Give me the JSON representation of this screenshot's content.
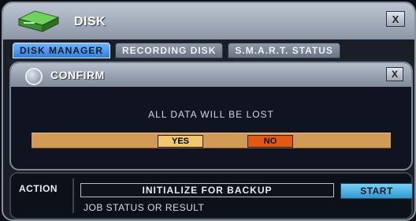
{
  "window": {
    "title": "DISK",
    "close_label": "X"
  },
  "tabs": [
    {
      "label": "DISK MANAGER",
      "active": true
    },
    {
      "label": "RECORDING DISK",
      "active": false
    },
    {
      "label": "S.M.A.R.T. STATUS",
      "active": false
    }
  ],
  "dialog": {
    "title": "CONFIRM",
    "close_label": "X",
    "message": "ALL DATA WILL BE LOST",
    "yes_label": "YES",
    "no_label": "NO"
  },
  "action": {
    "label": "ACTION",
    "value": "INITIALIZE FOR BACKUP",
    "start_label": "START",
    "status_text": "JOB STATUS OR RESULT"
  },
  "colors": {
    "accent_tab": "#2f7fdc",
    "button_bar": "#d29a57",
    "yes_button": "#f0c86b",
    "no_button": "#e25a12",
    "start_button": "#2f98d2"
  },
  "icons": {
    "window_icon": "disk-icon",
    "dialog_icon": "circle-icon"
  }
}
